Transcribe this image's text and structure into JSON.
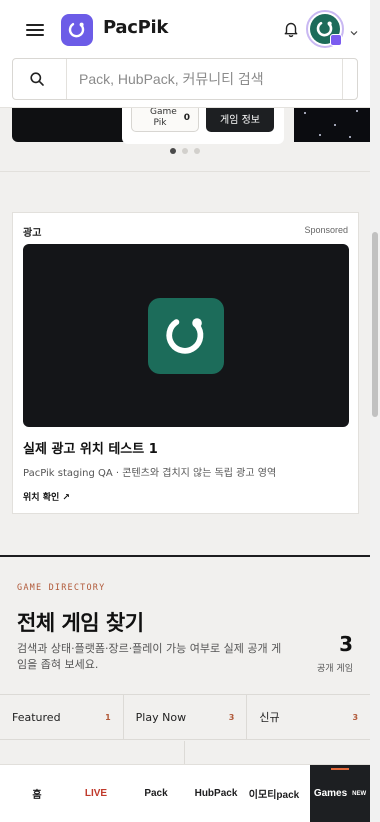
{
  "header": {
    "brand": "PacPik",
    "search_placeholder": "Pack, HubPack, 커뮤니티 검색"
  },
  "carousel": {
    "chip_label": "Game Pik",
    "chip_count": "0",
    "info_button": "게임 정보",
    "dot_count": 3,
    "active_dot": 0
  },
  "ad": {
    "label": "광고",
    "sponsored": "Sponsored",
    "title": "실제 광고 위치 테스트 1",
    "description": "PacPik staging QA · 콘텐츠와 겹치지 않는 독립 광고 영역",
    "link": "위치 확인"
  },
  "directory": {
    "eyebrow": "GAME DIRECTORY",
    "title": "전체 게임 찾기",
    "description": "검색과 상태·플랫폼·장르·플레이 가능 여부로 실제 공개 게임을 좁혀 보세요.",
    "count": "3",
    "count_label": "공개 게임",
    "filters": [
      {
        "label": "Featured",
        "count": "1"
      },
      {
        "label": "Play Now",
        "count": "3"
      },
      {
        "label": "신규",
        "count": "3"
      }
    ]
  },
  "bottom_nav": {
    "items": [
      "홈",
      "LIVE",
      "Pack",
      "HubPack",
      "이모티pack"
    ],
    "games_label": "Games",
    "games_badge": "NEW"
  },
  "colors": {
    "brand": "#6c5ce7",
    "accent": "#b15a3a",
    "live": "#c0392b",
    "logo_green": "#1c6c5a"
  }
}
